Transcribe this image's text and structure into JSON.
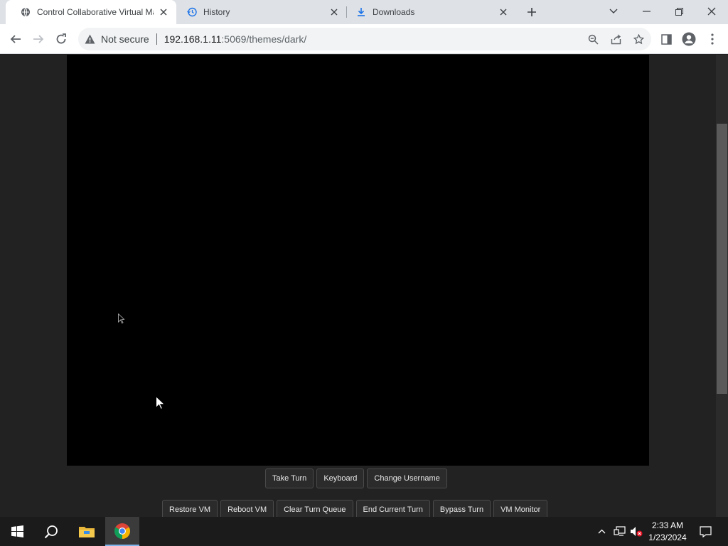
{
  "browser": {
    "tabs": [
      {
        "title": "Control Collaborative Virtual Mac",
        "icon": "globe-icon",
        "active": true
      },
      {
        "title": "History",
        "icon": "history-icon",
        "active": false
      },
      {
        "title": "Downloads",
        "icon": "download-icon",
        "active": false
      }
    ],
    "security_label": "Not secure",
    "url_host": "192.168.1.11",
    "url_path": ":5069/themes/dark/"
  },
  "vm": {
    "primary_buttons": [
      "Take Turn",
      "Keyboard",
      "Change Username"
    ],
    "admin_buttons": [
      "Restore VM",
      "Reboot VM",
      "Clear Turn Queue",
      "End Current Turn",
      "Bypass Turn",
      "VM Monitor"
    ]
  },
  "taskbar": {
    "time": "2:33 AM",
    "date": "1/23/2024"
  },
  "colors": {
    "page_bg": "#222222",
    "vm_screen": "#000000",
    "button_bg": "#2b2b2b",
    "taskbar_bg": "#1b1b1b"
  }
}
